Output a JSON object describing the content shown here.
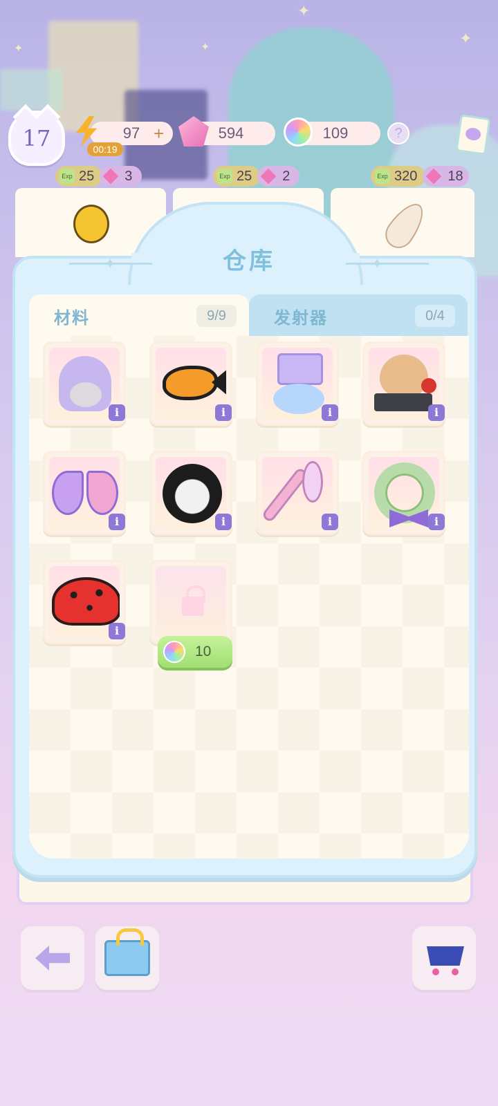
{
  "hud": {
    "level": "17",
    "energy": "97",
    "energy_timer": "00:19",
    "energy_add": "+",
    "gems": "594",
    "flowers": "109",
    "help": "?"
  },
  "orders": [
    {
      "exp": "25",
      "gems": "3",
      "exp_icon": "Exp"
    },
    {
      "exp": "25",
      "gems": "2",
      "exp_icon": "Exp"
    },
    {
      "exp": "320",
      "gems": "18",
      "exp_icon": "Exp"
    }
  ],
  "warehouse": {
    "title": "仓库",
    "tabs": [
      {
        "label": "材料",
        "count": "9/9",
        "active": true
      },
      {
        "label": "发射器",
        "count": "0/4",
        "active": false
      }
    ],
    "items": [
      {
        "icon": "purple-hooded-cat-icon"
      },
      {
        "icon": "goldfish-icon"
      },
      {
        "icon": "top-hat-cloud-icon"
      },
      {
        "icon": "bear-phone-icon"
      },
      {
        "icon": "fairy-butterfly-icon"
      },
      {
        "icon": "shadow-ghost-icon"
      },
      {
        "icon": "flower-wand-icon"
      },
      {
        "icon": "flower-wreath-icon"
      },
      {
        "icon": "ladybug-icon"
      }
    ],
    "info_glyph": "i",
    "locked_slot": {
      "cost": "10",
      "currency": "rainbow-flower-icon"
    }
  },
  "colors": {
    "panel": "#dcf1fb",
    "tab_text": "#7fb7d3",
    "info_badge": "#8d78d8",
    "unlock_button": "#a1df73"
  }
}
